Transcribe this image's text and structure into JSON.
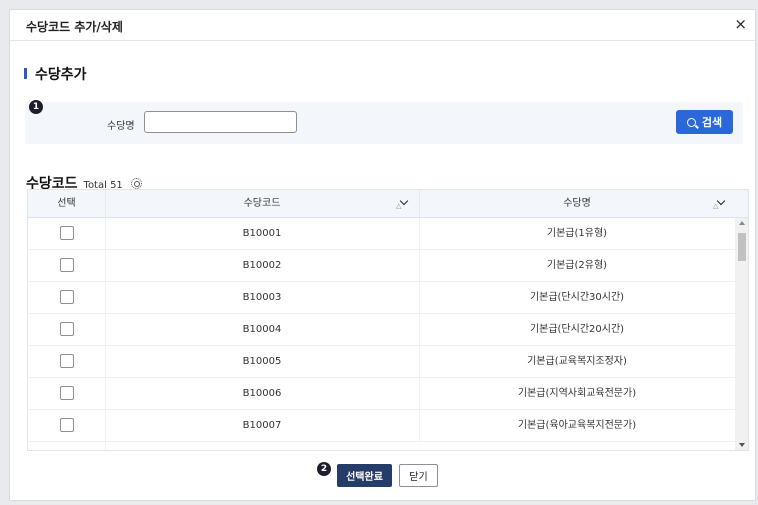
{
  "dialog": {
    "title": "수당코드 추가/삭제",
    "close_icon": "×"
  },
  "section": {
    "title": "수당추가"
  },
  "search": {
    "badge": "1",
    "label": "수당명",
    "value": "",
    "placeholder": "",
    "button_label": "검색"
  },
  "grid": {
    "title": "수당코드",
    "total_label": "Total 51",
    "columns": [
      "선택",
      "수당코드",
      "수당명"
    ],
    "rows": [
      {
        "code": "B10001",
        "name": "기본급(1유형)"
      },
      {
        "code": "B10002",
        "name": "기본급(2유형)"
      },
      {
        "code": "B10003",
        "name": "기본급(단시간30시간)"
      },
      {
        "code": "B10004",
        "name": "기본급(단시간20시간)"
      },
      {
        "code": "B10005",
        "name": "기본급(교육복지조정자)"
      },
      {
        "code": "B10006",
        "name": "기본급(지역사회교육전문가)"
      },
      {
        "code": "B10007",
        "name": "기본급(육아교육복지전문가)"
      }
    ]
  },
  "footer": {
    "badge": "2",
    "confirm_label": "선택완료",
    "close_label": "닫기"
  },
  "colors": {
    "accent": "#2a67d8",
    "primary_dark": "#253b68",
    "section_bar": "#2a57c9"
  }
}
